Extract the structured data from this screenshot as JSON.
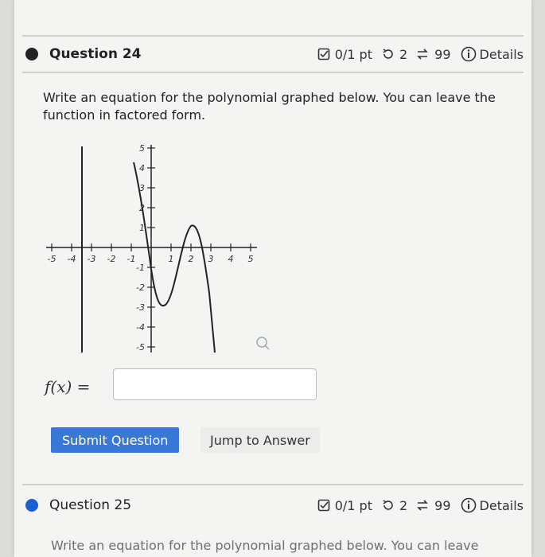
{
  "question_current": {
    "title": "Question 24",
    "score": "0/1 pt",
    "retries": "2",
    "attempts": "99",
    "details_label": "Details",
    "prompt": "Write an equation for the polynomial graphed below. You can leave the function in factored form."
  },
  "graph": {
    "x_ticks": [
      "-5",
      "-4",
      "-3",
      "-2",
      "-1",
      "1",
      "2",
      "3",
      "4",
      "5"
    ],
    "y_ticks": [
      "5",
      "4",
      "3",
      "2",
      "1",
      "-1",
      "-2",
      "-3",
      "-4",
      "-5"
    ]
  },
  "answer": {
    "label": "f(x) =",
    "value": ""
  },
  "buttons": {
    "submit": "Submit Question",
    "jump": "Jump to Answer"
  },
  "question_next": {
    "title": "Question 25",
    "score": "0/1 pt",
    "retries": "2",
    "attempts": "99",
    "details_label": "Details",
    "prompt_cutoff": "Write an equation for the polynomial graphed below. You can leave"
  },
  "colors": {
    "current_dot": "#222222",
    "next_dot": "#1b5fd1",
    "submit_bg": "#3a78d8"
  }
}
